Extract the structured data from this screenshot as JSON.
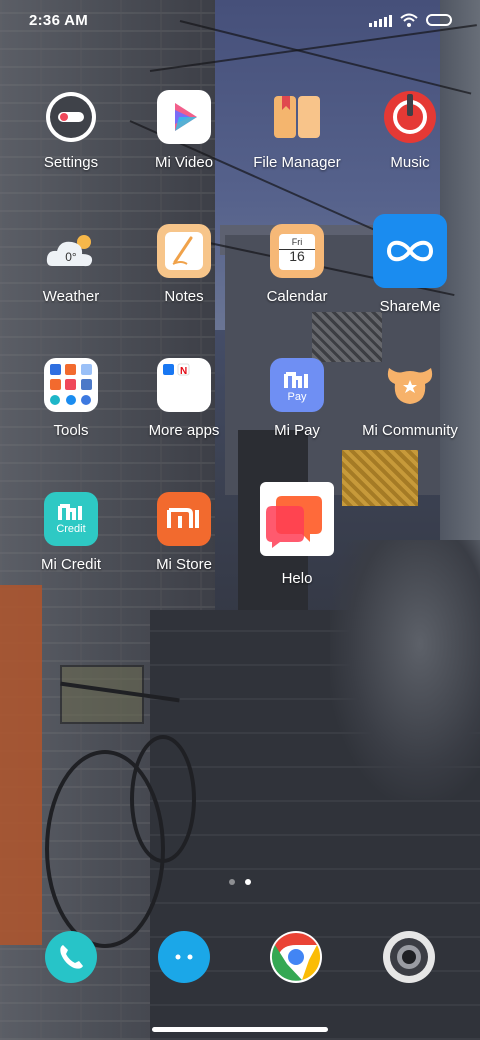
{
  "status_bar": {
    "time": "2:36 AM"
  },
  "apps": [
    {
      "label": "Settings",
      "icon": "settings-icon"
    },
    {
      "label": "Mi Video",
      "icon": "mi-video-icon"
    },
    {
      "label": "File Manager",
      "icon": "file-manager-icon"
    },
    {
      "label": "Music",
      "icon": "music-icon"
    },
    {
      "label": "Weather",
      "icon": "weather-icon",
      "badge_text": "0°"
    },
    {
      "label": "Notes",
      "icon": "notes-icon"
    },
    {
      "label": "Calendar",
      "icon": "calendar-icon",
      "day": "Fri",
      "date": "16"
    },
    {
      "label": "ShareMe",
      "icon": "shareme-icon"
    },
    {
      "label": "Tools",
      "icon": "tools-folder-icon"
    },
    {
      "label": "More apps",
      "icon": "more-apps-folder-icon"
    },
    {
      "label": "Mi Pay",
      "icon": "mi-pay-icon",
      "icon_text": "Pay"
    },
    {
      "label": "Mi Community",
      "icon": "mi-community-icon"
    },
    {
      "label": "Mi Credit",
      "icon": "mi-credit-icon",
      "icon_text": "Credit"
    },
    {
      "label": "Mi Store",
      "icon": "mi-store-icon"
    },
    {
      "label": "Helo",
      "icon": "helo-icon"
    }
  ],
  "page_indicator": {
    "pages": 2,
    "current": 2
  },
  "dock": [
    {
      "name": "phone",
      "icon": "phone-icon"
    },
    {
      "name": "messages",
      "icon": "messages-icon"
    },
    {
      "name": "chrome",
      "icon": "chrome-icon"
    },
    {
      "name": "camera",
      "icon": "camera-icon"
    }
  ],
  "colors": {
    "accent_blue": "#1a8cf0",
    "music_red": "#e53935",
    "mi_store_orange": "#f26a2e",
    "mi_credit_teal": "#2ec9c4",
    "mi_pay_blue": "#6f8ff3",
    "phone_teal": "#27c4c8",
    "messages_blue": "#1ba7e8"
  }
}
